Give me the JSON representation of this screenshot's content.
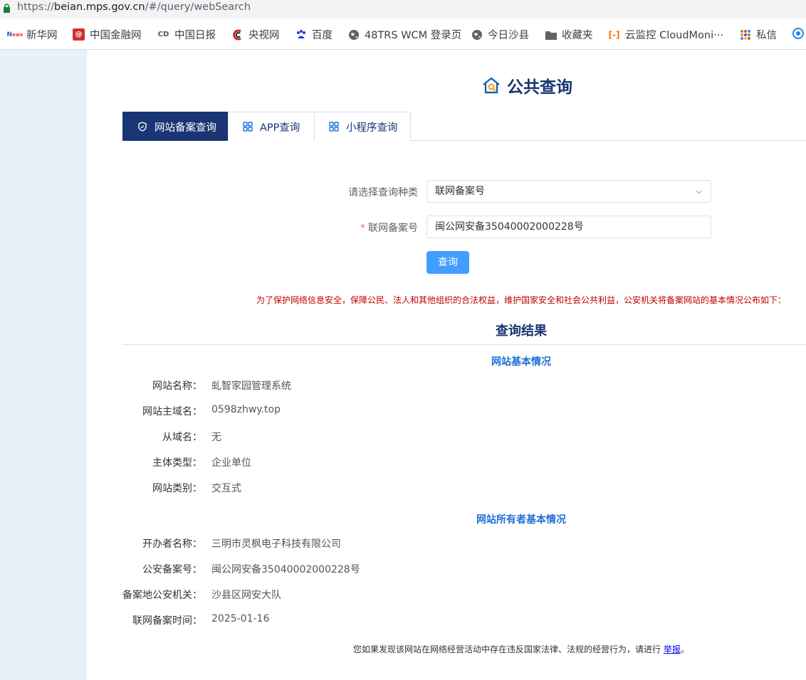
{
  "browser": {
    "url_scheme": "https://",
    "url_host": "beian.mps.gov.cn",
    "url_path": "/#/query/webSearch"
  },
  "bookmarks": [
    {
      "label": "新华网",
      "icon": "news-icon"
    },
    {
      "label": "中国金融网",
      "icon": "finance-icon"
    },
    {
      "label": "中国日报",
      "icon": "chinadaily-icon"
    },
    {
      "label": "央视网",
      "icon": "cctv-icon"
    },
    {
      "label": "百度",
      "icon": "baidu-icon"
    },
    {
      "label": "48TRS WCM 登录页",
      "icon": "globe-icon"
    },
    {
      "label": "今日沙县",
      "icon": "globe-icon"
    },
    {
      "label": "收藏夹",
      "icon": "folder-icon"
    },
    {
      "label": "云监控 CloudMoni···",
      "icon": "aliyun-icon"
    },
    {
      "label": "私信",
      "icon": "apps-icon"
    }
  ],
  "header": {
    "title": "公共查询"
  },
  "tabs": [
    {
      "label": "网站备案查询",
      "active": true
    },
    {
      "label": "APP查询",
      "active": false
    },
    {
      "label": "小程序查询",
      "active": false
    }
  ],
  "form": {
    "type_label": "请选择查询种类",
    "type_value": "联网备案号",
    "number_label": "联网备案号",
    "number_required": "*",
    "number_value": "闽公网安备35040002000228号",
    "submit_label": "查询"
  },
  "notice": "为了保护网络信息安全，保障公民、法人和其他组织的合法权益，维护国家安全和社会公共利益，公安机关将备案网站的基本情况公布如下：",
  "result": {
    "title": "查询结果",
    "site_section": "网站基本情况",
    "site_rows": [
      {
        "key": "网站名称：",
        "value": "虬智家园管理系统"
      },
      {
        "key": "网站主域名：",
        "value": "0598zhwy.top"
      },
      {
        "key": "从域名：",
        "value": "无"
      },
      {
        "key": "主体类型：",
        "value": "企业单位"
      },
      {
        "key": "网站类别：",
        "value": "交互式"
      }
    ],
    "owner_section": "网站所有者基本情况",
    "owner_rows": [
      {
        "key": "开办者名称：",
        "value": "三明市灵枫电子科技有限公司"
      },
      {
        "key": "公安备案号：",
        "value": "闽公网安备35040002000228号"
      },
      {
        "key": "备案地公安机关：",
        "value": "沙县区网安大队"
      },
      {
        "key": "联网备案时间：",
        "value": "2025-01-16"
      }
    ]
  },
  "report": {
    "text": "您如果发现该网站在网络经营活动中存在违反国家法律、法规的经营行为，请进行",
    "link": "举报",
    "end": "。"
  },
  "colors": {
    "primary": "#1a3573",
    "accent": "#409eff",
    "section": "#1e6fd9",
    "notice": "#c00000",
    "sidebar": "#e8f0f8"
  }
}
